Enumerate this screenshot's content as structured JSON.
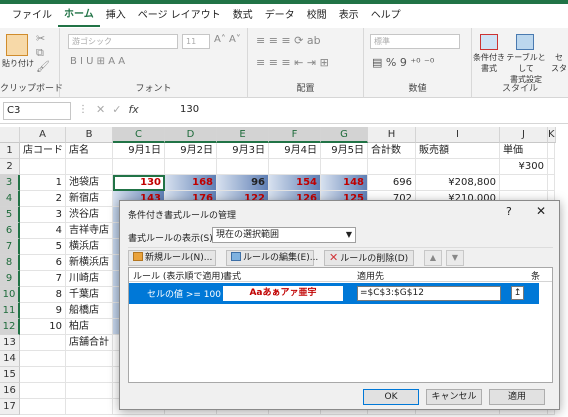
{
  "ribbon_tabs": [
    "ファイル",
    "ホーム",
    "挿入",
    "ページ レイアウト",
    "数式",
    "データ",
    "校閲",
    "表示",
    "ヘルプ"
  ],
  "active_tab": "ホーム",
  "ribbon": {
    "paste": "貼り付け",
    "font_name": "游ゴシック",
    "font_size": "11",
    "number_format": "標準",
    "conditional_format": "条件付き\n書式",
    "format_as_table": "テーブルとして\n書式設定",
    "cell_styles": "セ\nスタ",
    "groups": [
      "クリップボード",
      "フォント",
      "配置",
      "数値",
      "スタイル"
    ]
  },
  "formula_bar": {
    "name_box": "C3",
    "fx": "fx",
    "value": "130"
  },
  "columns": [
    "A",
    "B",
    "C",
    "D",
    "E",
    "F",
    "G",
    "H",
    "I",
    "J",
    "K"
  ],
  "rows": [
    {
      "n": "1",
      "cells": [
        "店コード",
        "店名",
        "9月1日",
        "9月2日",
        "9月3日",
        "9月4日",
        "9月5日",
        "合計数",
        "販売額",
        "単価",
        ""
      ]
    },
    {
      "n": "2",
      "cells": [
        "",
        "",
        "",
        "",
        "",
        "",
        "",
        "",
        "",
        "¥300",
        ""
      ]
    },
    {
      "n": "3",
      "cells": [
        "1",
        "池袋店",
        "130",
        "168",
        "96",
        "154",
        "148",
        "696",
        "¥208,800",
        "",
        ""
      ]
    },
    {
      "n": "4",
      "cells": [
        "2",
        "新宿店",
        "143",
        "176",
        "122",
        "126",
        "125",
        "702",
        "¥210,000",
        "",
        ""
      ]
    },
    {
      "n": "5",
      "cells": [
        "3",
        "渋谷店",
        "",
        "",
        "",
        "",
        "",
        "",
        "",
        "",
        ""
      ]
    },
    {
      "n": "6",
      "cells": [
        "4",
        "吉祥寺店",
        "",
        "",
        "",
        "",
        "",
        "",
        "",
        "",
        ""
      ]
    },
    {
      "n": "7",
      "cells": [
        "5",
        "横浜店",
        "",
        "",
        "",
        "",
        "",
        "",
        "",
        "",
        ""
      ]
    },
    {
      "n": "8",
      "cells": [
        "6",
        "新横浜店",
        "",
        "",
        "",
        "",
        "",
        "",
        "",
        "",
        ""
      ]
    },
    {
      "n": "9",
      "cells": [
        "7",
        "川崎店",
        "",
        "",
        "",
        "",
        "",
        "",
        "",
        "",
        ""
      ]
    },
    {
      "n": "10",
      "cells": [
        "8",
        "千葉店",
        "",
        "",
        "",
        "",
        "",
        "",
        "",
        "",
        ""
      ]
    },
    {
      "n": "11",
      "cells": [
        "9",
        "船橋店",
        "",
        "",
        "",
        "",
        "",
        "",
        "",
        "",
        ""
      ]
    },
    {
      "n": "12",
      "cells": [
        "10",
        "柏店",
        "",
        "",
        "",
        "",
        "",
        "",
        "",
        "",
        ""
      ]
    },
    {
      "n": "13",
      "cells": [
        "",
        "店舗合計",
        "",
        "",
        "",
        "",
        "",
        "",
        "",
        "",
        ""
      ]
    },
    {
      "n": "14",
      "cells": [
        "",
        "",
        "",
        "",
        "",
        "",
        "",
        "",
        "",
        "",
        ""
      ]
    },
    {
      "n": "15",
      "cells": [
        "",
        "",
        "",
        "",
        "",
        "",
        "",
        "",
        "",
        "",
        ""
      ]
    },
    {
      "n": "16",
      "cells": [
        "",
        "",
        "",
        "",
        "",
        "",
        "",
        "",
        "",
        "",
        ""
      ]
    },
    {
      "n": "17",
      "cells": [
        "",
        "",
        "",
        "",
        "",
        "",
        "",
        "",
        "",
        "",
        ""
      ]
    }
  ],
  "highlight_color": "#c00000",
  "dialog": {
    "title": "条件付き書式ルールの管理",
    "help": "?",
    "close": "✕",
    "show_label": "書式ルールの表示(S):",
    "show_value": "現在の選択範囲",
    "new_rule": "新規ルール(N)...",
    "edit_rule": "ルールの編集(E)...",
    "delete_rule": "ルールの削除(D)",
    "col_rule": "ルール (表示順で適用)",
    "col_format": "書式",
    "col_applies": "適用先",
    "col_stop": "条",
    "rule_condition": "セルの値 >= 100",
    "rule_format": "Aaあぁアァ亜宇",
    "rule_applies": "=$C$3:$G$12",
    "ok": "OK",
    "cancel": "キャンセル",
    "apply": "適用"
  }
}
